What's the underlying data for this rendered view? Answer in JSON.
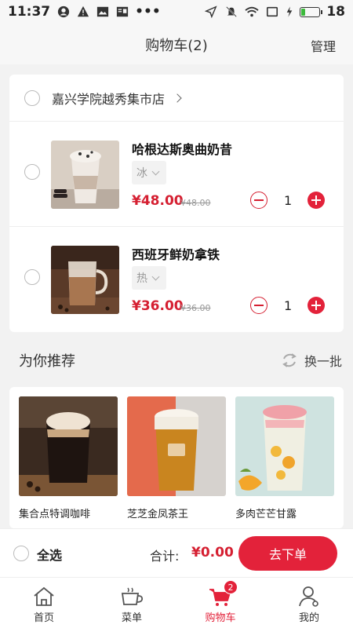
{
  "status_bar": {
    "time": "11:37",
    "battery_level": "18",
    "battery_fraction": 0.18
  },
  "header": {
    "title": "购物车(2)",
    "manage": "管理"
  },
  "cart": {
    "store_name": "嘉兴学院越秀集市店",
    "items": [
      {
        "name": "哈根达斯奥曲奶昔",
        "option": "冰",
        "price": "¥48.00",
        "original_price": "¥48.00",
        "quantity": "1"
      },
      {
        "name": "西班牙鲜奶拿铁",
        "option": "热",
        "price": "¥36.00",
        "original_price": "¥36.00",
        "quantity": "1"
      }
    ]
  },
  "recommend": {
    "title": "为你推荐",
    "refresh_label": "换一批",
    "items": [
      {
        "name": "集合点特调咖啡"
      },
      {
        "name": "芝芝金凤茶王"
      },
      {
        "name": "多肉芒芒甘露"
      }
    ]
  },
  "checkout": {
    "select_all": "全选",
    "total_label": "合计:",
    "total_amount": "¥0.00",
    "order_button": "去下单"
  },
  "tabbar": {
    "tabs": [
      {
        "label": "首页",
        "icon": "home-icon"
      },
      {
        "label": "菜单",
        "icon": "cup-icon"
      },
      {
        "label": "购物车",
        "icon": "cart-icon",
        "badge": "2",
        "active": true
      },
      {
        "label": "我的",
        "icon": "user-icon"
      }
    ]
  },
  "colors": {
    "accent": "#e3223a",
    "price": "#d51f31",
    "background": "#f2f2f2"
  }
}
